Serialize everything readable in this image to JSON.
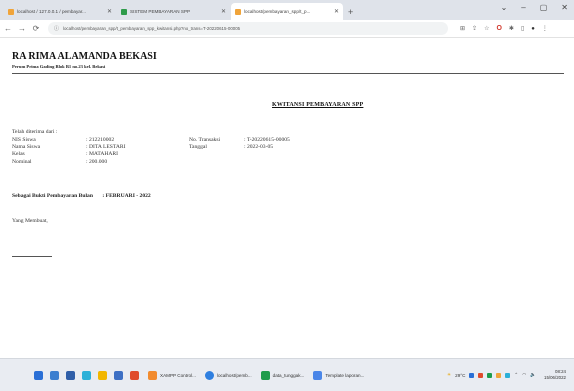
{
  "browser": {
    "tabs": [
      {
        "title": "localhost / 127.0.0.1 / pembayar...",
        "favicon_color": "#f0a43a"
      },
      {
        "title": "SISTEM PEMBAYARAN SPP",
        "favicon_color": "#2e9b4a"
      },
      {
        "title": "localhost/pembayaran_spp/t_p...",
        "favicon_color": "#f0a43a"
      }
    ],
    "address": "localhost/pembayaran_spp/t_pembayaran_spp_kwitansi.php?no_trans=T-20220615-00005",
    "window_controls": [
      "⌄",
      "–",
      "▢",
      "✕"
    ]
  },
  "header": {
    "school_name": "RA RIMA ALAMANDA BEKASI",
    "address": "Perum Prima Gading Blok B1 no.23 kel. Bekasi"
  },
  "receipt": {
    "title": "KWITANSI PEMBAYARAN SPP",
    "received_label": "Telah diterima dari :",
    "student_fields": [
      {
        "label": "NIS Siswa",
        "value": ": 212210002"
      },
      {
        "label": "Nama Siswa",
        "value": ": DITA LESTARI"
      },
      {
        "label": "Kelas",
        "value": ": MATAHARI"
      },
      {
        "label": "Nominal",
        "value": ": 200.000"
      }
    ],
    "transaction_fields": [
      {
        "label": "No. Transaksi",
        "value": ": T-20220615-00005"
      },
      {
        "label": "Tanggal",
        "value": ": 2022-03-05"
      }
    ],
    "proof_label": "Sebagai Bukti Pembayaran Bulan",
    "proof_value": ": FEBRUARI - 2022",
    "signer_label": "Yang Membuat,"
  },
  "taskbar": {
    "apps": [
      {
        "label": "XAMPP Control...",
        "color": "#f28b2e"
      },
      {
        "label": "localhost/pemb...",
        "color": "#2f7fe0"
      },
      {
        "label": "data_tunggak...",
        "color": "#1f9c4c"
      },
      {
        "label": "Template laporan...",
        "color": "#4a86e8"
      }
    ],
    "weather": "29°C",
    "time": "08:24",
    "date": "15/06/2022"
  }
}
